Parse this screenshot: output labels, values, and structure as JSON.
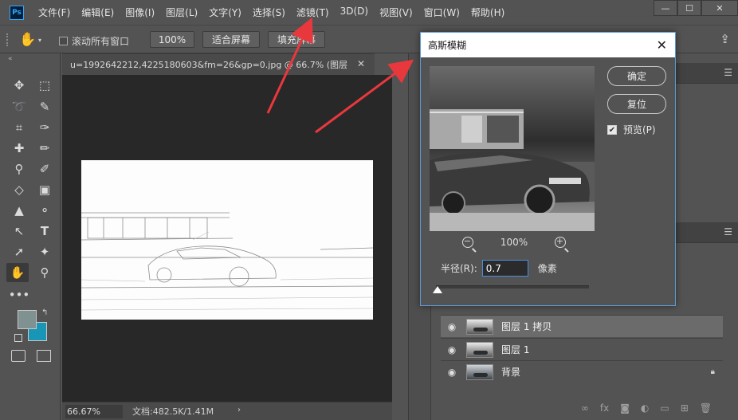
{
  "app": {
    "logo": "Ps"
  },
  "menu": [
    "文件(F)",
    "编辑(E)",
    "图像(I)",
    "图层(L)",
    "文字(Y)",
    "选择(S)",
    "滤镜(T)",
    "3D(D)",
    "视图(V)",
    "窗口(W)",
    "帮助(H)"
  ],
  "window_controls": {
    "minimize": "—",
    "maximize": "☐",
    "close": "✕"
  },
  "options_bar": {
    "scroll_all": "滚动所有窗口",
    "zoom_100": "100%",
    "fit_screen": "适合屏幕",
    "fill_screen": "填充屏幕"
  },
  "document": {
    "tab_title": "u=1992642212,4225180603&fm=26&gp=0.jpg @ 66.7% (图层",
    "zoom": "66.67%",
    "info": "文档:482.5K/1.41M"
  },
  "dialog": {
    "title": "高斯模糊",
    "ok": "确定",
    "reset": "复位",
    "preview_label": "预览(P)",
    "preview_checked": true,
    "zoom_percent": "100%",
    "radius_label": "半径(R):",
    "radius_value": "0.7",
    "radius_unit": "像素"
  },
  "layers": [
    {
      "name": "图层 1 拷贝",
      "selected": true,
      "locked": false
    },
    {
      "name": "图层 1",
      "selected": false,
      "locked": false
    },
    {
      "name": "背景",
      "selected": false,
      "locked": true
    }
  ],
  "colors": {
    "foreground": "#7f9190",
    "background": "#1995b5",
    "annotation_arrow": "#e8383d"
  }
}
